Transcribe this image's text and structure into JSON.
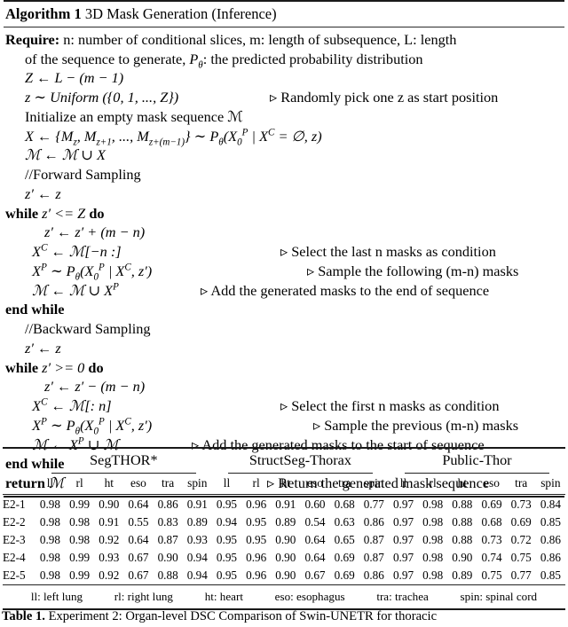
{
  "algorithm": {
    "label": "Algorithm 1",
    "title": "3D Mask Generation (Inference)",
    "require_label": "Require:",
    "require_text_1": "n: number of conditional slices, m: length of subsequence, L: length",
    "require_text_2a": "of the sequence to generate, ",
    "require_text_2b": ": the predicted probability distribution",
    "lines": {
      "l1": "Z ← L − (m − 1)",
      "l2": "z ∼ Uniform ({0, 1, ..., Z})",
      "l2_comment": "▹ Randomly pick one z as start position",
      "l3": "Initialize an empty mask sequence ℳ",
      "l4": "X ← {M_z, M_{z+1}, ..., M_{z+(m−1)}} ∼ Pθ(X₀ᴾ | Xᶜ = ∅, z)",
      "l5": "ℳ ← ℳ ∪ X",
      "l6": "//Forward Sampling",
      "l7": "z′ ← z",
      "l8_kw_a": "while",
      "l8_mid": "z′ <= Z",
      "l8_kw_b": "do",
      "l9": "z′ ← z′ + (m − n)",
      "l10": "Xᶜ ← ℳ[−n :]",
      "l10_comment": "▹ Select the last n masks as condition",
      "l11": "Xᴾ ∼ Pθ(X₀ᴾ | Xᶜ, z′)",
      "l11_comment": "▹ Sample the following (m-n) masks",
      "l12": "ℳ ← ℳ ∪ Xᴾ",
      "l12_comment": "▹ Add the generated masks to the end of sequence",
      "l13": "end while",
      "l14": "//Backward Sampling",
      "l15": "z′ ← z",
      "l16_kw_a": "while",
      "l16_mid": "z′ >= 0",
      "l16_kw_b": "do",
      "l17": "z′ ← z′ − (m − n)",
      "l18": "Xᶜ ← ℳ[: n]",
      "l18_comment": "▹ Select the first n masks as condition",
      "l19": "Xᴾ ∼ Pθ(X₀ᴾ | Xᶜ, z′)",
      "l19_comment": "▹ Sample the previous (m-n) masks",
      "l20": "ℳ ← Xᴾ ∪ ℳ",
      "l20_comment": "▹ Add the generated masks to the start of sequence",
      "l21": "end while",
      "l22_kw": "return",
      "l22_rest": "ℳ",
      "l22_comment": "▹ Return the generated mask sequence"
    }
  },
  "table": {
    "groups": [
      "SegTHOR*",
      "StructSeg-Thorax",
      "Public-Thor"
    ],
    "subheaders": [
      "ll",
      "rl",
      "ht",
      "eso",
      "tra",
      "spin"
    ],
    "rows": [
      {
        "label": "E2-1",
        "cells": [
          {
            "v": "0.98",
            "b": true
          },
          {
            "v": "0.99",
            "b": true
          },
          {
            "v": "0.90",
            "b": false
          },
          {
            "v": "0.64",
            "b": false
          },
          {
            "v": "0.86",
            "b": false
          },
          {
            "v": "0.91",
            "b": false
          },
          {
            "v": "0.95",
            "b": true
          },
          {
            "v": "0.96",
            "b": true
          },
          {
            "v": "0.91",
            "b": true
          },
          {
            "v": "0.60",
            "b": false
          },
          {
            "v": "0.68",
            "b": false
          },
          {
            "v": "0.77",
            "b": false
          },
          {
            "v": "0.97",
            "b": true
          },
          {
            "v": "0.98",
            "b": true
          },
          {
            "v": "0.88",
            "b": false
          },
          {
            "v": "0.69",
            "b": false
          },
          {
            "v": "0.73",
            "b": false
          },
          {
            "v": "0.84",
            "b": false
          }
        ]
      },
      {
        "label": "E2-2",
        "cells": [
          {
            "v": "0.98",
            "b": true
          },
          {
            "v": "0.98",
            "b": false
          },
          {
            "v": "0.91",
            "b": false
          },
          {
            "v": "0.55",
            "b": false
          },
          {
            "v": "0.83",
            "b": false
          },
          {
            "v": "0.89",
            "b": false
          },
          {
            "v": "0.94",
            "b": false
          },
          {
            "v": "0.95",
            "b": false
          },
          {
            "v": "0.89",
            "b": false
          },
          {
            "v": "0.54",
            "b": false
          },
          {
            "v": "0.63",
            "b": false
          },
          {
            "v": "0.86",
            "b": false
          },
          {
            "v": "0.97",
            "b": true
          },
          {
            "v": "0.98",
            "b": true
          },
          {
            "v": "0.88",
            "b": false
          },
          {
            "v": "0.68",
            "b": false
          },
          {
            "v": "0.69",
            "b": false
          },
          {
            "v": "0.85",
            "b": false
          }
        ]
      },
      {
        "label": "E2-3",
        "cells": [
          {
            "v": "0.98",
            "b": true
          },
          {
            "v": "0.98",
            "b": false
          },
          {
            "v": "0.92",
            "b": false
          },
          {
            "v": "0.64",
            "b": false
          },
          {
            "v": "0.87",
            "b": false
          },
          {
            "v": "0.93",
            "b": false
          },
          {
            "v": "0.95",
            "b": true
          },
          {
            "v": "0.95",
            "b": false
          },
          {
            "v": "0.90",
            "b": false
          },
          {
            "v": "0.64",
            "b": false
          },
          {
            "v": "0.65",
            "b": false
          },
          {
            "v": "0.87",
            "b": true
          },
          {
            "v": "0.97",
            "b": true
          },
          {
            "v": "0.98",
            "b": true
          },
          {
            "v": "0.88",
            "b": false
          },
          {
            "v": "0.73",
            "b": false
          },
          {
            "v": "0.72",
            "b": false
          },
          {
            "v": "0.86",
            "b": true
          }
        ]
      },
      {
        "label": "E2-4",
        "cells": [
          {
            "v": "0.98",
            "b": true
          },
          {
            "v": "0.99",
            "b": true
          },
          {
            "v": "0.93",
            "b": true
          },
          {
            "v": "0.67",
            "b": true
          },
          {
            "v": "0.90",
            "b": true
          },
          {
            "v": "0.94",
            "b": true
          },
          {
            "v": "0.95",
            "b": true
          },
          {
            "v": "0.96",
            "b": true
          },
          {
            "v": "0.90",
            "b": false
          },
          {
            "v": "0.64",
            "b": false
          },
          {
            "v": "0.69",
            "b": true
          },
          {
            "v": "0.87",
            "b": true
          },
          {
            "v": "0.97",
            "b": true
          },
          {
            "v": "0.98",
            "b": true
          },
          {
            "v": "0.90",
            "b": true
          },
          {
            "v": "0.74",
            "b": false
          },
          {
            "v": "0.75",
            "b": false
          },
          {
            "v": "0.86",
            "b": true
          }
        ]
      },
      {
        "label": "E2-5",
        "cells": [
          {
            "v": "0.98",
            "b": true
          },
          {
            "v": "0.99",
            "b": true
          },
          {
            "v": "0.92",
            "b": false
          },
          {
            "v": "0.67",
            "b": true
          },
          {
            "v": "0.88",
            "b": false
          },
          {
            "v": "0.94",
            "b": true
          },
          {
            "v": "0.95",
            "b": true
          },
          {
            "v": "0.96",
            "b": true
          },
          {
            "v": "0.90",
            "b": false
          },
          {
            "v": "0.67",
            "b": true
          },
          {
            "v": "0.69",
            "b": true
          },
          {
            "v": "0.86",
            "b": false
          },
          {
            "v": "0.97",
            "b": true
          },
          {
            "v": "0.98",
            "b": true
          },
          {
            "v": "0.89",
            "b": false
          },
          {
            "v": "0.75",
            "b": true
          },
          {
            "v": "0.77",
            "b": true
          },
          {
            "v": "0.85",
            "b": false
          }
        ]
      }
    ],
    "legend": [
      "ll: left lung",
      "rl: right lung",
      "ht: heart",
      "eso: esophagus",
      "tra: trachea",
      "spin: spinal cord"
    ]
  },
  "caption": {
    "label": "Table 1.",
    "text": "Experiment 2: Organ-level DSC Comparison of Swin-UNETR for thoracic"
  }
}
